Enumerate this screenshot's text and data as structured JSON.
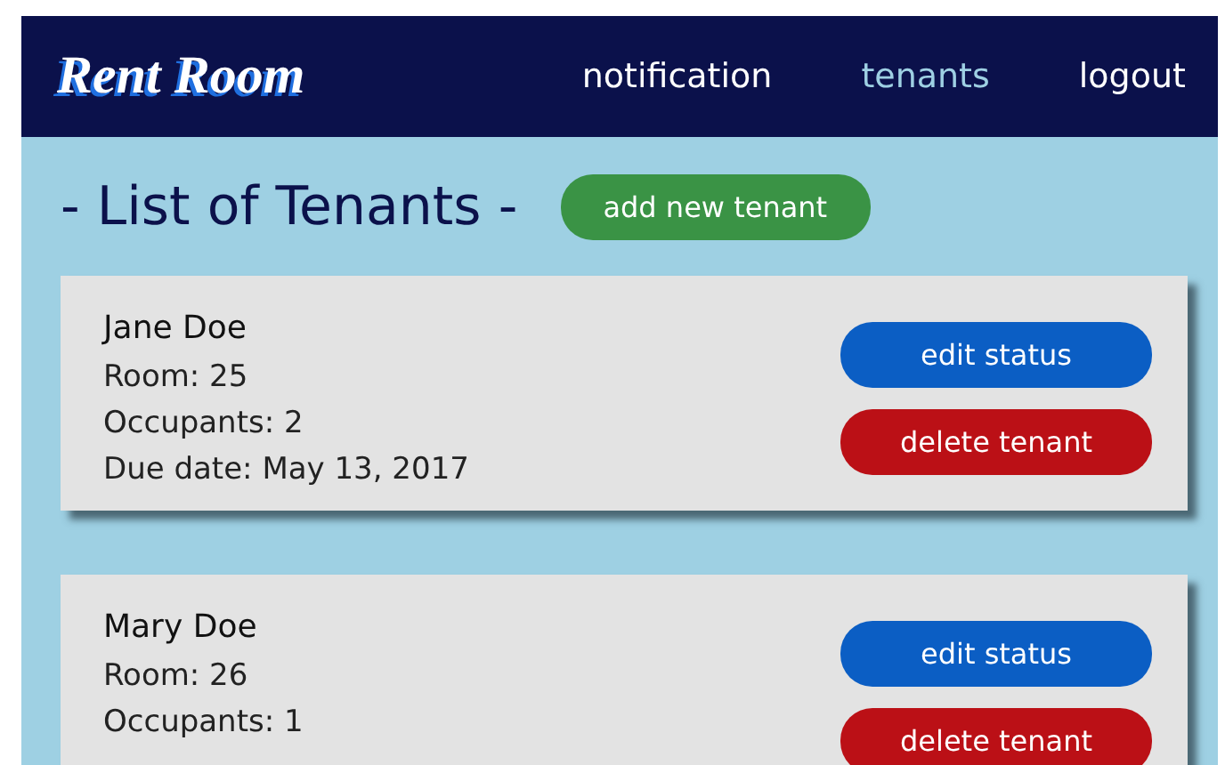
{
  "brand": "Rent Room",
  "nav": [
    {
      "label": "notification",
      "selected": false
    },
    {
      "label": "tenants",
      "selected": true
    },
    {
      "label": "logout",
      "selected": false
    }
  ],
  "page_title": "- List of Tenants -",
  "add_button": "add new tenant",
  "tenants": [
    {
      "name": "Jane Doe",
      "room": "Room: 25",
      "occupants": "Occupants: 2",
      "due": "Due date: May 13, 2017",
      "edit": "edit status",
      "delete": "delete tenant"
    },
    {
      "name": "Mary Doe",
      "room": "Room: 26",
      "occupants": "Occupants: 1",
      "edit": "edit status",
      "delete": "delete tenant"
    }
  ]
}
